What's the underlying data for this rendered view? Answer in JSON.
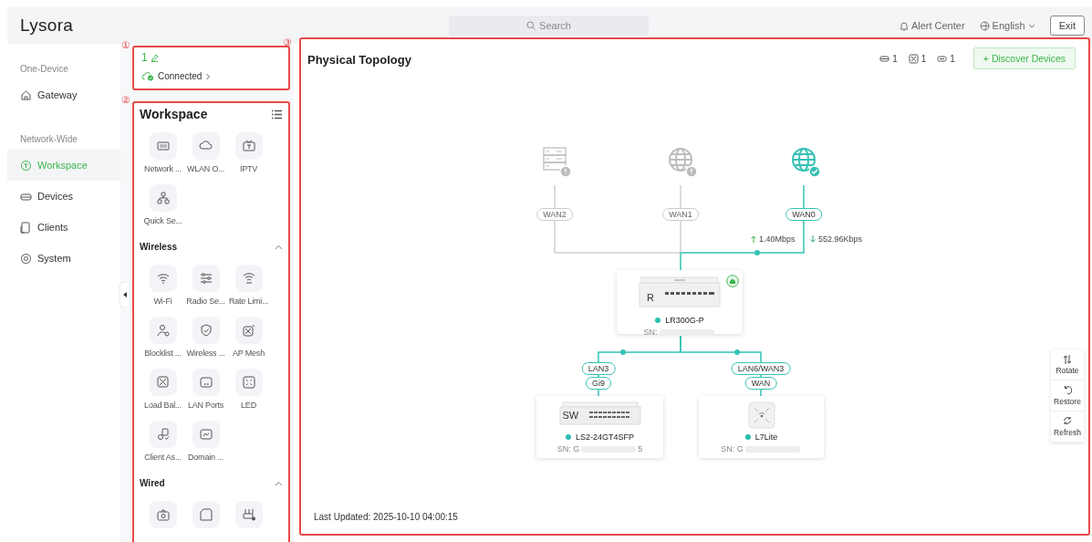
{
  "header": {
    "logo": "Lysora",
    "search_placeholder": "Search",
    "alert_center": "Alert Center",
    "language": "English",
    "exit": "Exit"
  },
  "sidebar": {
    "sections": [
      {
        "label": "One-Device",
        "items": [
          {
            "label": "Gateway",
            "selected": false
          }
        ]
      },
      {
        "label": "Network-Wide",
        "items": [
          {
            "label": "Workspace",
            "selected": true
          },
          {
            "label": "Devices",
            "selected": false
          },
          {
            "label": "Clients",
            "selected": false
          },
          {
            "label": "System",
            "selected": false
          }
        ]
      }
    ]
  },
  "annotations": [
    "①",
    "②",
    "③"
  ],
  "status_card": {
    "count": "1",
    "status": "Connected"
  },
  "workspace": {
    "title": "Workspace",
    "groups": [
      {
        "items": [
          {
            "kind": "labeled",
            "label": "Network ..."
          },
          {
            "kind": "labeled",
            "label": "WLAN O..."
          },
          {
            "kind": "labeled",
            "label": "IPTV"
          },
          {
            "kind": "labeled",
            "label": "Quick Se..."
          }
        ]
      },
      {
        "title": "Wireless",
        "expanded": true,
        "items": [
          {
            "kind": "labeled",
            "label": "Wi-Fi"
          },
          {
            "kind": "labeled",
            "label": "Radio Se..."
          },
          {
            "kind": "labeled",
            "label": "Rate Limi..."
          },
          {
            "kind": "labeled",
            "label": "Blocklist ..."
          },
          {
            "kind": "labeled",
            "label": "Wireless ..."
          },
          {
            "kind": "labeled",
            "label": "AP Mesh"
          },
          {
            "kind": "labeled",
            "label": "Load Bal..."
          },
          {
            "kind": "labeled",
            "label": "LAN Ports"
          },
          {
            "kind": "labeled",
            "label": "LED"
          },
          {
            "kind": "labeled",
            "label": "Client As..."
          },
          {
            "kind": "labeled",
            "label": "Domain ..."
          }
        ]
      },
      {
        "title": "Wired",
        "expanded": true,
        "items": [
          {
            "kind": "cut"
          },
          {
            "kind": "cut"
          },
          {
            "kind": "cut"
          }
        ]
      }
    ]
  },
  "topology": {
    "title": "Physical Topology",
    "counts": [
      "1",
      "1",
      "1"
    ],
    "discover_button": "+ Discover Devices",
    "uplinks": [
      {
        "label": "WAN2",
        "kind": "server",
        "connected": false
      },
      {
        "label": "WAN1",
        "kind": "globe",
        "connected": false
      },
      {
        "label": "WAN0",
        "kind": "globe",
        "connected": true
      }
    ],
    "upload": "1.40Mbps",
    "download": "552.96Kbps",
    "gateway": {
      "badge": "R",
      "model": "LR300G-P",
      "sn": "SN:",
      "online": true
    },
    "links": [
      {
        "port": "LAN3",
        "peer_port": "Gi9"
      },
      {
        "port": "LAN6/WAN3",
        "peer_port": "WAN"
      }
    ],
    "devices": [
      {
        "kind": "switch",
        "badge": "SW",
        "name": "LS2-24GT4SFP",
        "sn_start": "SN: G",
        "sn_end": "5",
        "online": true
      },
      {
        "kind": "ap",
        "name": "L7Lite",
        "sn_start": "SN: G",
        "online": true
      }
    ],
    "tools": [
      "Rotate",
      "Restore",
      "Refresh"
    ],
    "last_updated": "Last Updated: 2025-10-10 04:00:15"
  }
}
